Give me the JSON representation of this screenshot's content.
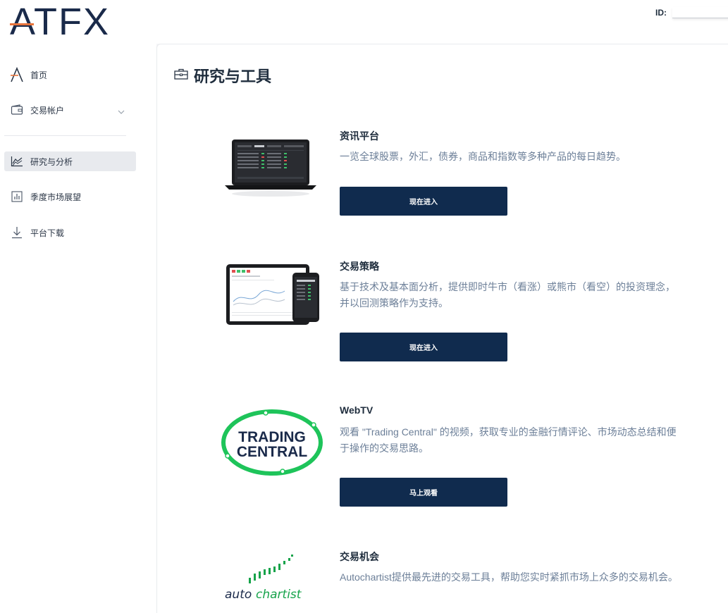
{
  "brand": {
    "logo_text": "ATFX",
    "accent": "#e8743b",
    "navy": "#102b4e"
  },
  "header": {
    "id_label": "ID:",
    "id_value": ""
  },
  "sidebar": {
    "items": [
      {
        "label": "首页",
        "icon": "atfx-logo-icon"
      },
      {
        "label": "交易帐户",
        "icon": "wallet-icon"
      },
      {
        "label": "研究与分析",
        "icon": "chart-area-icon",
        "active": true
      },
      {
        "label": "季度市场展望",
        "icon": "bar-chart-icon"
      },
      {
        "label": "平台下载",
        "icon": "download-icon"
      }
    ]
  },
  "page": {
    "title": "研究与工具",
    "title_icon": "briefcase-icon",
    "cards": [
      {
        "title": "资讯平台",
        "desc": "一览全球股票，外汇，债券，商品和指数等多种产品的每日趋势。",
        "button": "现在进入",
        "image": "laptop-image"
      },
      {
        "title": "交易策略",
        "desc": "基于技术及基本面分析，提供即时牛市（看涨）或熊市（看空）的投资理念，并以回测策略作为支持。",
        "button": "现在进入",
        "image": "tablet-phone-image"
      },
      {
        "title": "WebTV",
        "desc": "观看 \"Trading Central\" 的视频，获取专业的金融行情评论、市场动态总结和便于操作的交易思路。",
        "button": "马上观看",
        "image": "trading-central-logo",
        "logo_text_1": "TRADING",
        "logo_text_2": "CENTRAL"
      },
      {
        "title": "交易机会",
        "desc": "Autochartist提供最先进的交易工具，帮助您实时紧抓市场上众多的交易机会。",
        "image": "autochartist-logo",
        "logo_text_a": "auto",
        "logo_text_b": "chartist"
      }
    ]
  }
}
